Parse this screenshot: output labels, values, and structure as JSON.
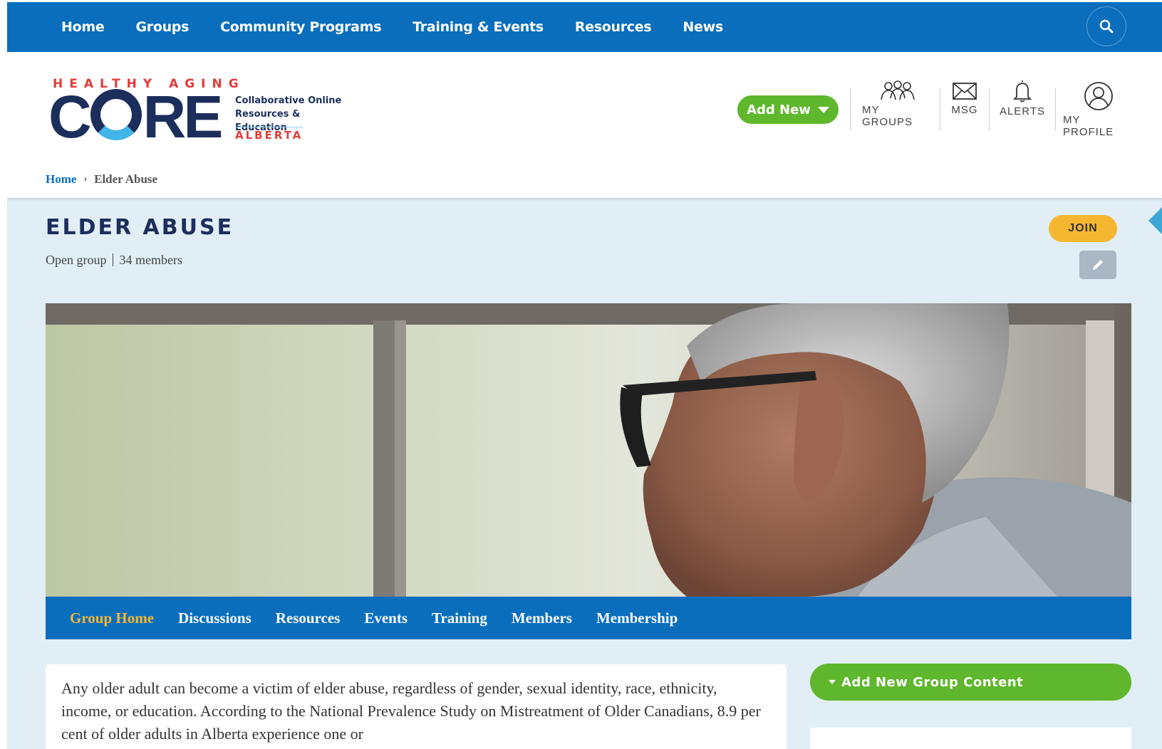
{
  "topnav": {
    "items": [
      "Home",
      "Groups",
      "Community Programs",
      "Training & Events",
      "Resources",
      "News"
    ],
    "search_icon": "search-icon"
  },
  "logo": {
    "tagline": "HEALTHY AGING",
    "wordmark_c": "C",
    "wordmark_re": "RE",
    "subtitle_1": "Collaborative Online",
    "subtitle_2": "Resources & Education",
    "region": "ALBERTA"
  },
  "header": {
    "add_new": "Add New",
    "utilities": [
      {
        "label": "MY GROUPS",
        "icon": "groups-icon"
      },
      {
        "label": "MSG",
        "icon": "envelope-icon"
      },
      {
        "label": "ALERTS",
        "icon": "bell-icon"
      },
      {
        "label": "MY PROFILE",
        "icon": "user-icon"
      }
    ]
  },
  "breadcrumb": {
    "home": "Home",
    "separator": "›",
    "current": "Elder Abuse"
  },
  "group": {
    "title": "ELDER ABUSE",
    "type": "Open group",
    "members": "34 members",
    "join": "JOIN",
    "edit_icon": "pencil-icon"
  },
  "subnav": {
    "items": [
      "Group Home",
      "Discussions",
      "Resources",
      "Events",
      "Training",
      "Members",
      "Membership"
    ],
    "active": "Group Home"
  },
  "content": {
    "intro": "Any older adult can become a victim of elder abuse, regardless of gender, sexual identity, race, ethnicity, income, or education. According to the National Prevalence Study on Mistreatment of Older Canadians, 8.9 per cent of older adults in Alberta experience one or"
  },
  "sidebar": {
    "add_group_content": "Add New Group Content"
  },
  "colors": {
    "nav_blue": "#0a6ebd",
    "brand_navy": "#1c2e5c",
    "brand_red": "#e63a3a",
    "green": "#5eb72c",
    "join_yellow": "#f5b731",
    "band_bg": "#e1eef6"
  }
}
